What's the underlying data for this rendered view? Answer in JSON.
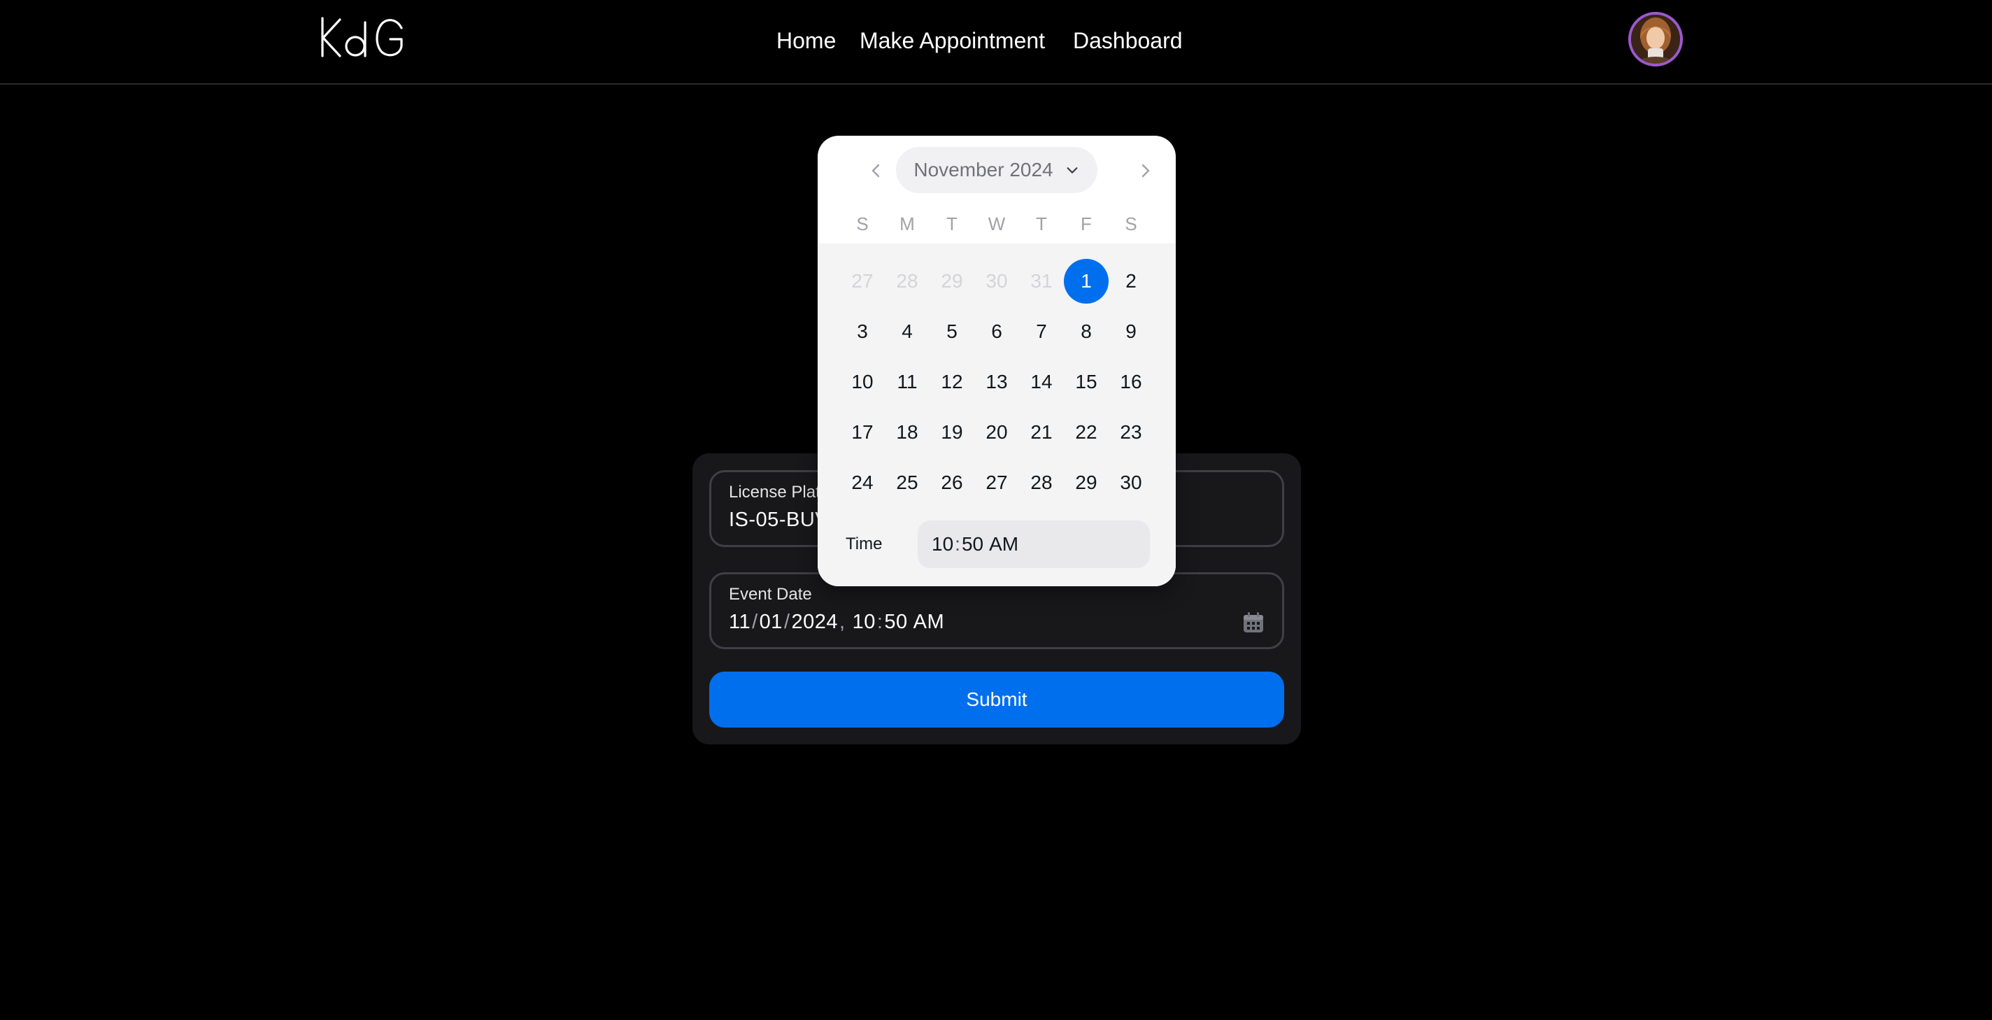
{
  "header": {
    "logo_text": "KdG",
    "nav": {
      "home": "Home",
      "make_appointment": "Make Appointment",
      "dashboard": "Dashboard"
    },
    "avatar_icon": "user-avatar"
  },
  "form": {
    "license_plate": {
      "label": "License Plate",
      "value": "IS-05-BUV"
    },
    "event_date": {
      "label": "Event Date",
      "month": "11",
      "day": "01",
      "year": "2024",
      "date_sep": "/",
      "comma": ",",
      "hour": "10",
      "minute": "50",
      "time_sep": ":",
      "period": "AM",
      "icon": "calendar-icon"
    },
    "submit_label": "Submit"
  },
  "calendar": {
    "month_label": "November 2024",
    "weekdays": [
      "S",
      "M",
      "T",
      "W",
      "T",
      "F",
      "S"
    ],
    "weeks": [
      [
        "27",
        "28",
        "29",
        "30",
        "31",
        "1",
        "2"
      ],
      [
        "3",
        "4",
        "5",
        "6",
        "7",
        "8",
        "9"
      ],
      [
        "10",
        "11",
        "12",
        "13",
        "14",
        "15",
        "16"
      ],
      [
        "17",
        "18",
        "19",
        "20",
        "21",
        "22",
        "23"
      ],
      [
        "24",
        "25",
        "26",
        "27",
        "28",
        "29",
        "30"
      ]
    ],
    "selected_day": "1",
    "time": {
      "label": "Time",
      "hour": "10",
      "minute": "50",
      "sep": ":",
      "period": "AM"
    }
  },
  "colors": {
    "accent": "#006fee",
    "avatar_ring": "#9b59d0",
    "card_bg": "#18181b"
  }
}
